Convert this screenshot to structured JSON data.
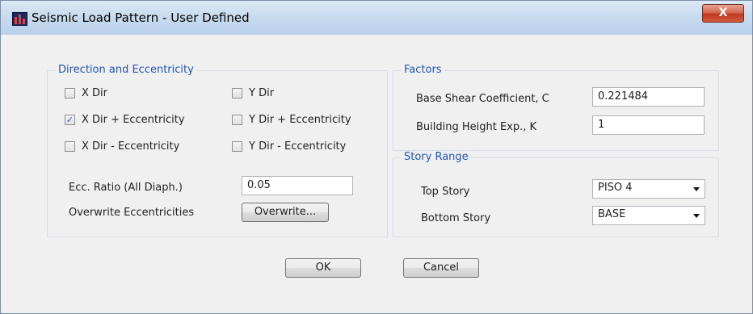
{
  "window": {
    "title": "Seismic Load Pattern - User Defined",
    "close_label": "X"
  },
  "direction": {
    "group_label": "Direction and Eccentricity",
    "checkboxes": [
      {
        "label": "X Dir",
        "checked": false
      },
      {
        "label": "X Dir + Eccentricity",
        "checked": true
      },
      {
        "label": "X Dir - Eccentricity",
        "checked": false
      },
      {
        "label": "Y Dir",
        "checked": false
      },
      {
        "label": "Y Dir + Eccentricity",
        "checked": false
      },
      {
        "label": "Y Dir - Eccentricity",
        "checked": false
      }
    ],
    "ecc_ratio_label": "Ecc. Ratio (All Diaph.)",
    "ecc_ratio_value": "0.05",
    "overwrite_label": "Overwrite Eccentricities",
    "overwrite_button": "Overwrite..."
  },
  "factors": {
    "group_label": "Factors",
    "base_shear_label": "Base Shear Coefficient, C",
    "base_shear_value": "0.221484",
    "height_exp_label": "Building Height Exp., K",
    "height_exp_value": "1"
  },
  "story_range": {
    "group_label": "Story Range",
    "top_label": "Top Story",
    "top_value": "PISO 4",
    "bottom_label": "Bottom Story",
    "bottom_value": "BASE"
  },
  "buttons": {
    "ok": "OK",
    "cancel": "Cancel"
  }
}
